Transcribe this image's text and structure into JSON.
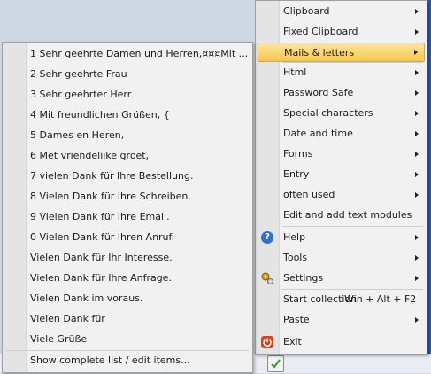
{
  "submenu": {
    "items": [
      {
        "label": "1 Sehr geehrte Damen und Herren,¤¤¤Mit ..."
      },
      {
        "label": "2 Sehr geehrte Frau"
      },
      {
        "label": "3 Sehr geehrter Herr"
      },
      {
        "label": "4 Mit freundlichen Grüßen, {"
      },
      {
        "label": "5 Dames en Heren,"
      },
      {
        "label": "6 Met vriendelijke groet,"
      },
      {
        "label": "7 vielen Dank für Ihre Bestellung."
      },
      {
        "label": "8 Vielen Dank für Ihre Schreiben."
      },
      {
        "label": "9 Vielen Dank für Ihre Email."
      },
      {
        "label": "0 Vielen Dank für Ihren Anruf."
      },
      {
        "label": "Vielen Dank für Ihr Interesse."
      },
      {
        "label": "Vielen Dank für Ihre Anfrage."
      },
      {
        "label": "Vielen Dank im voraus."
      },
      {
        "label": "Vielen Dank für"
      },
      {
        "label": "Viele Grüße"
      }
    ],
    "footer": {
      "label": "Show complete list / edit items..."
    }
  },
  "mainmenu": {
    "items": [
      {
        "label": "Clipboard",
        "submenu": true
      },
      {
        "label": "Fixed Clipboard",
        "submenu": true
      },
      {
        "label": "Mails & letters",
        "submenu": true,
        "highlighted": true
      },
      {
        "label": "Html",
        "submenu": true
      },
      {
        "label": "Password Safe",
        "submenu": true
      },
      {
        "label": "Special characters",
        "submenu": true
      },
      {
        "label": "Date and time",
        "submenu": true
      },
      {
        "label": "Forms",
        "submenu": true
      },
      {
        "label": "Entry",
        "submenu": true
      },
      {
        "label": "often used",
        "submenu": true
      },
      {
        "label": "Edit and add text modules",
        "submenu": false
      },
      {
        "label": "Help",
        "submenu": true,
        "icon": "help-icon"
      },
      {
        "label": "Tools",
        "submenu": true
      },
      {
        "label": "Settings",
        "submenu": true,
        "icon": "settings-gear-icon"
      },
      {
        "label": "Start collection",
        "shortcut": "Win + Alt + F2",
        "submenu": false
      },
      {
        "label": "Paste",
        "submenu": true
      },
      {
        "label": "Exit",
        "submenu": false,
        "icon": "power-icon"
      }
    ]
  },
  "colors": {
    "highlight": "#f7c64f",
    "help_icon": "#2f6fd1",
    "exit_icon": "#d9421f"
  }
}
